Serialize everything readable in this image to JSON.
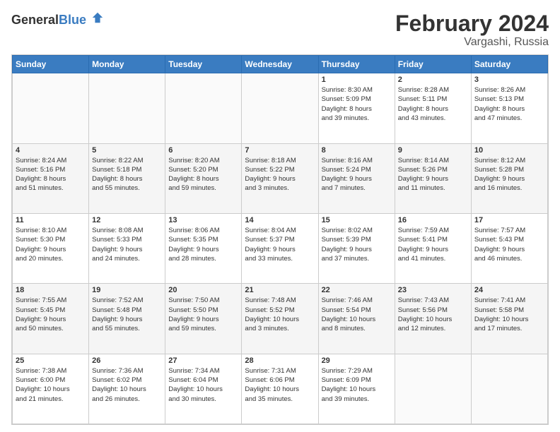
{
  "header": {
    "logo_general": "General",
    "logo_blue": "Blue",
    "title": "February 2024",
    "subtitle": "Vargashi, Russia"
  },
  "days_of_week": [
    "Sunday",
    "Monday",
    "Tuesday",
    "Wednesday",
    "Thursday",
    "Friday",
    "Saturday"
  ],
  "weeks": [
    [
      {
        "day": "",
        "info": ""
      },
      {
        "day": "",
        "info": ""
      },
      {
        "day": "",
        "info": ""
      },
      {
        "day": "",
        "info": ""
      },
      {
        "day": "1",
        "info": "Sunrise: 8:30 AM\nSunset: 5:09 PM\nDaylight: 8 hours\nand 39 minutes."
      },
      {
        "day": "2",
        "info": "Sunrise: 8:28 AM\nSunset: 5:11 PM\nDaylight: 8 hours\nand 43 minutes."
      },
      {
        "day": "3",
        "info": "Sunrise: 8:26 AM\nSunset: 5:13 PM\nDaylight: 8 hours\nand 47 minutes."
      }
    ],
    [
      {
        "day": "4",
        "info": "Sunrise: 8:24 AM\nSunset: 5:16 PM\nDaylight: 8 hours\nand 51 minutes."
      },
      {
        "day": "5",
        "info": "Sunrise: 8:22 AM\nSunset: 5:18 PM\nDaylight: 8 hours\nand 55 minutes."
      },
      {
        "day": "6",
        "info": "Sunrise: 8:20 AM\nSunset: 5:20 PM\nDaylight: 8 hours\nand 59 minutes."
      },
      {
        "day": "7",
        "info": "Sunrise: 8:18 AM\nSunset: 5:22 PM\nDaylight: 9 hours\nand 3 minutes."
      },
      {
        "day": "8",
        "info": "Sunrise: 8:16 AM\nSunset: 5:24 PM\nDaylight: 9 hours\nand 7 minutes."
      },
      {
        "day": "9",
        "info": "Sunrise: 8:14 AM\nSunset: 5:26 PM\nDaylight: 9 hours\nand 11 minutes."
      },
      {
        "day": "10",
        "info": "Sunrise: 8:12 AM\nSunset: 5:28 PM\nDaylight: 9 hours\nand 16 minutes."
      }
    ],
    [
      {
        "day": "11",
        "info": "Sunrise: 8:10 AM\nSunset: 5:30 PM\nDaylight: 9 hours\nand 20 minutes."
      },
      {
        "day": "12",
        "info": "Sunrise: 8:08 AM\nSunset: 5:33 PM\nDaylight: 9 hours\nand 24 minutes."
      },
      {
        "day": "13",
        "info": "Sunrise: 8:06 AM\nSunset: 5:35 PM\nDaylight: 9 hours\nand 28 minutes."
      },
      {
        "day": "14",
        "info": "Sunrise: 8:04 AM\nSunset: 5:37 PM\nDaylight: 9 hours\nand 33 minutes."
      },
      {
        "day": "15",
        "info": "Sunrise: 8:02 AM\nSunset: 5:39 PM\nDaylight: 9 hours\nand 37 minutes."
      },
      {
        "day": "16",
        "info": "Sunrise: 7:59 AM\nSunset: 5:41 PM\nDaylight: 9 hours\nand 41 minutes."
      },
      {
        "day": "17",
        "info": "Sunrise: 7:57 AM\nSunset: 5:43 PM\nDaylight: 9 hours\nand 46 minutes."
      }
    ],
    [
      {
        "day": "18",
        "info": "Sunrise: 7:55 AM\nSunset: 5:45 PM\nDaylight: 9 hours\nand 50 minutes."
      },
      {
        "day": "19",
        "info": "Sunrise: 7:52 AM\nSunset: 5:48 PM\nDaylight: 9 hours\nand 55 minutes."
      },
      {
        "day": "20",
        "info": "Sunrise: 7:50 AM\nSunset: 5:50 PM\nDaylight: 9 hours\nand 59 minutes."
      },
      {
        "day": "21",
        "info": "Sunrise: 7:48 AM\nSunset: 5:52 PM\nDaylight: 10 hours\nand 3 minutes."
      },
      {
        "day": "22",
        "info": "Sunrise: 7:46 AM\nSunset: 5:54 PM\nDaylight: 10 hours\nand 8 minutes."
      },
      {
        "day": "23",
        "info": "Sunrise: 7:43 AM\nSunset: 5:56 PM\nDaylight: 10 hours\nand 12 minutes."
      },
      {
        "day": "24",
        "info": "Sunrise: 7:41 AM\nSunset: 5:58 PM\nDaylight: 10 hours\nand 17 minutes."
      }
    ],
    [
      {
        "day": "25",
        "info": "Sunrise: 7:38 AM\nSunset: 6:00 PM\nDaylight: 10 hours\nand 21 minutes."
      },
      {
        "day": "26",
        "info": "Sunrise: 7:36 AM\nSunset: 6:02 PM\nDaylight: 10 hours\nand 26 minutes."
      },
      {
        "day": "27",
        "info": "Sunrise: 7:34 AM\nSunset: 6:04 PM\nDaylight: 10 hours\nand 30 minutes."
      },
      {
        "day": "28",
        "info": "Sunrise: 7:31 AM\nSunset: 6:06 PM\nDaylight: 10 hours\nand 35 minutes."
      },
      {
        "day": "29",
        "info": "Sunrise: 7:29 AM\nSunset: 6:09 PM\nDaylight: 10 hours\nand 39 minutes."
      },
      {
        "day": "",
        "info": ""
      },
      {
        "day": "",
        "info": ""
      }
    ]
  ]
}
